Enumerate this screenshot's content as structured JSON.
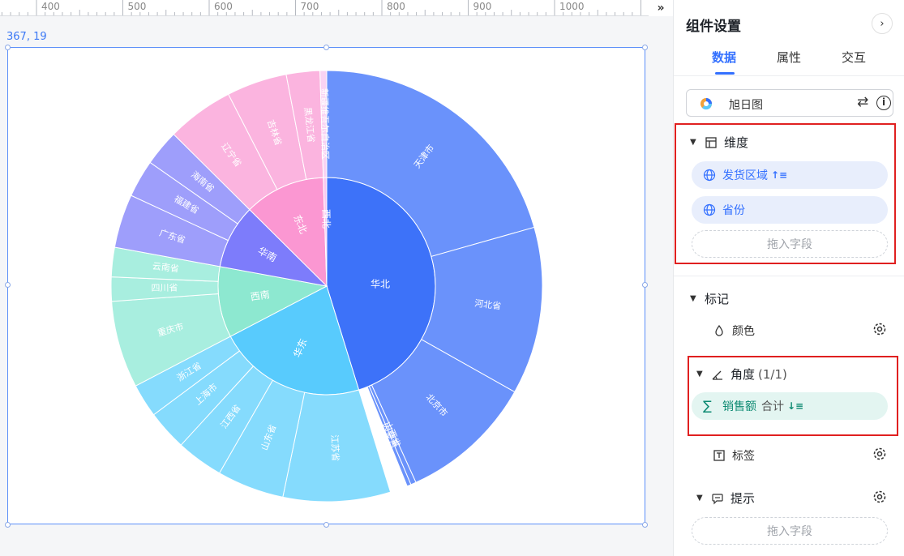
{
  "ruler": {
    "ticks": [
      "400",
      "500",
      "600",
      "700",
      "800",
      "900",
      "1000"
    ],
    "expand_label": "»"
  },
  "canvas": {
    "coord_label": "367, 19"
  },
  "panel": {
    "title": "组件设置",
    "close_label": "›",
    "tabs": [
      {
        "label": "数据",
        "active": true
      },
      {
        "label": "属性",
        "active": false
      },
      {
        "label": "交互",
        "active": false
      }
    ],
    "chart_type": {
      "label": "旭日图",
      "swap_label": "⇄",
      "info_label": "i"
    },
    "dimension": {
      "title": "维度",
      "fields": [
        {
          "label": "发货区域",
          "sort": "↑≡"
        },
        {
          "label": "省份",
          "sort": ""
        }
      ],
      "drop_label": "拖入字段"
    },
    "marks": {
      "title": "标记",
      "color_label": "颜色"
    },
    "angle": {
      "title": "角度",
      "count": "(1/1)",
      "field": {
        "label": "销售额",
        "agg": "合计",
        "sort": "↓≡"
      }
    },
    "label_row": {
      "label": "标签"
    },
    "tooltip": {
      "title": "提示",
      "drop_label": "拖入字段"
    }
  },
  "chart_data": {
    "type": "sunburst",
    "inner": [
      {
        "name": "华北",
        "value": 45.0,
        "color": "#3d72f9"
      },
      {
        "name": "华东",
        "value": 22.0,
        "color": "#58cbfd"
      },
      {
        "name": "西南",
        "value": 10.5,
        "color": "#8de8d0"
      },
      {
        "name": "华南",
        "value": 9.5,
        "color": "#7d7cfb"
      },
      {
        "name": "东北",
        "value": 12.0,
        "color": "#fb97d2"
      },
      {
        "name": "西北",
        "value": 0.5,
        "color": "#f9c8f0"
      }
    ],
    "outer": [
      {
        "name": "天津市",
        "parent": "华北",
        "value": 20.5,
        "color": "#6a92fb"
      },
      {
        "name": "河北省",
        "parent": "华北",
        "value": 12.5,
        "color": "#6a92fb"
      },
      {
        "name": "北京市",
        "parent": "华北",
        "value": 10.0,
        "color": "#6a92fb"
      },
      {
        "name": "山西省",
        "parent": "华北",
        "value": 0.4,
        "color": "#6a92fb"
      },
      {
        "name": "内蒙古",
        "parent": "华北",
        "value": 0.3,
        "color": "#6a92fb"
      },
      {
        "name": "江苏省",
        "parent": "华东",
        "value": 8.0,
        "color": "#85dbfd"
      },
      {
        "name": "山东省",
        "parent": "华东",
        "value": 5.0,
        "color": "#85dbfd"
      },
      {
        "name": "江西省",
        "parent": "华东",
        "value": 3.5,
        "color": "#85dbfd"
      },
      {
        "name": "上海市",
        "parent": "华东",
        "value": 3.0,
        "color": "#85dbfd"
      },
      {
        "name": "浙江省",
        "parent": "华东",
        "value": 2.5,
        "color": "#85dbfd"
      },
      {
        "name": "重庆市",
        "parent": "西南",
        "value": 6.5,
        "color": "#a8eedf"
      },
      {
        "name": "四川省",
        "parent": "西南",
        "value": 1.8,
        "color": "#a8eedf"
      },
      {
        "name": "云南省",
        "parent": "西南",
        "value": 2.2,
        "color": "#a8eedf"
      },
      {
        "name": "广东省",
        "parent": "华南",
        "value": 4.0,
        "color": "#9e9efb"
      },
      {
        "name": "福建省",
        "parent": "华南",
        "value": 2.8,
        "color": "#9e9efb"
      },
      {
        "name": "海南省",
        "parent": "华南",
        "value": 2.7,
        "color": "#9e9efb"
      },
      {
        "name": "辽宁省",
        "parent": "东北",
        "value": 5.0,
        "color": "#fbb4df"
      },
      {
        "name": "吉林省",
        "parent": "东北",
        "value": 4.5,
        "color": "#fbb4df"
      },
      {
        "name": "黑龙江省",
        "parent": "东北",
        "value": 2.5,
        "color": "#fbb4df"
      },
      {
        "name": "新疆维吾尔自治区",
        "parent": "西北",
        "value": 0.5,
        "color": "#f9d3f3"
      }
    ]
  }
}
